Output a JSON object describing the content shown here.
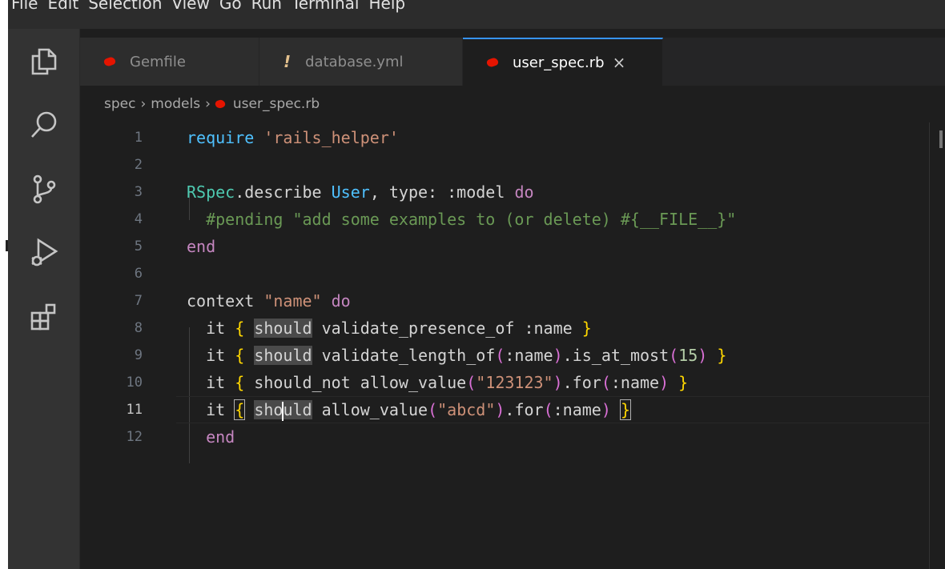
{
  "menu": [
    "File",
    "Edit",
    "Selection",
    "View",
    "Go",
    "Run",
    "Terminal",
    "Help"
  ],
  "activity_icons": [
    "explorer-icon",
    "search-icon",
    "source-control-icon",
    "run-debug-icon",
    "extensions-icon"
  ],
  "tabs": [
    {
      "label": "Gemfile",
      "icon": "ruby-icon"
    },
    {
      "label": "database.yml",
      "icon": "warning-icon",
      "icon_glyph": "!"
    },
    {
      "label": "user_spec.rb",
      "icon": "ruby-icon",
      "close": "×"
    }
  ],
  "breadcrumb": {
    "parts": [
      "spec",
      "models",
      "user_spec.rb"
    ],
    "separator": "›"
  },
  "editor": {
    "lines": [
      {
        "num": "1",
        "text": "require 'rails_helper'"
      },
      {
        "num": "2",
        "text": ""
      },
      {
        "num": "3",
        "text": "RSpec.describe User, type: :model do"
      },
      {
        "num": "4",
        "text": "  #pending \"add some examples to (or delete) #{__FILE__}\""
      },
      {
        "num": "5",
        "text": "end"
      },
      {
        "num": "6",
        "text": ""
      },
      {
        "num": "7",
        "text": "context \"name\" do"
      },
      {
        "num": "8",
        "text": "  it { should validate_presence_of :name }"
      },
      {
        "num": "9",
        "text": "  it { should validate_length_of(:name).is_at_most(15) }"
      },
      {
        "num": "10",
        "text": "  it { should_not allow_value(\"123123\").for(:name) }"
      },
      {
        "num": "11",
        "text": "  it { should allow_value(\"abcd\").for(:name) }"
      },
      {
        "num": "12",
        "text": "  end"
      }
    ],
    "current_line": "11"
  },
  "colors": {
    "accent": "#3794ff",
    "ruby": "#e51400",
    "background": "#1e1e1e"
  }
}
